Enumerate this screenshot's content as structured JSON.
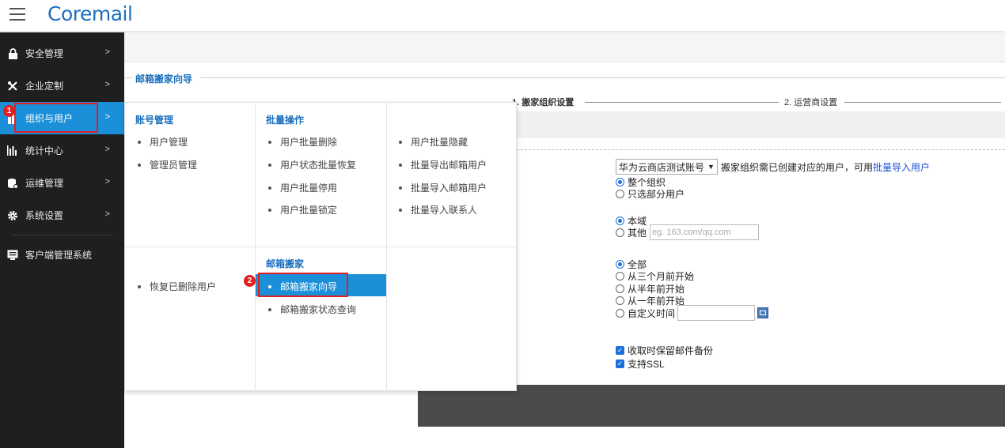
{
  "header": {
    "logo": "Coremail"
  },
  "sidebar": {
    "items": [
      {
        "label": "安全管理",
        "icon": "lock-icon"
      },
      {
        "label": "企业定制",
        "icon": "tools-icon"
      },
      {
        "label": "组织与用户",
        "icon": "org-icon",
        "active": true
      },
      {
        "label": "统计中心",
        "icon": "bar-chart-icon"
      },
      {
        "label": "运维管理",
        "icon": "database-icon"
      },
      {
        "label": "系统设置",
        "icon": "gear-icon"
      }
    ],
    "bottom_item": {
      "label": "客户端管理系统",
      "icon": "monitor-icon"
    }
  },
  "annotations": {
    "badge1": "1",
    "badge2": "2"
  },
  "page": {
    "section_title": "邮箱搬家向导",
    "step1": "1. 搬家组织设置",
    "step2": "2. 运营商设置"
  },
  "form": {
    "account_select": "华为云商店测试账号",
    "account_hint": "搬家组织需已创建对应的用户，可用",
    "account_link": "批量导入用户",
    "scope_all": "整个组织",
    "scope_partial": "只选部分用户",
    "domain_local": "本域",
    "domain_other": "其他",
    "domain_placeholder": "eg. 163.com/qq.com",
    "time_all": "全部",
    "time_3m": "从三个月前开始",
    "time_6m": "从半年前开始",
    "time_1y": "从一年前开始",
    "time_custom": "自定义时间",
    "keep_backup": "收取时保留邮件备份",
    "ssl": "支持SSL"
  },
  "menu": {
    "account_mgmt": {
      "title": "账号管理",
      "items": [
        "用户管理",
        "管理员管理"
      ]
    },
    "batch_ops": {
      "title": "批量操作",
      "col1": [
        "用户批量删除",
        "用户状态批量恢复",
        "用户批量停用",
        "用户批量锁定"
      ],
      "col2": [
        "用户批量隐藏",
        "批量导出邮箱用户",
        "批量导入邮箱用户",
        "批量导入联系人"
      ]
    },
    "restore": "恢复已删除用户",
    "migration": {
      "title": "邮箱搬家",
      "items": [
        "邮箱搬家向导",
        "邮箱搬家状态查询"
      ]
    }
  }
}
